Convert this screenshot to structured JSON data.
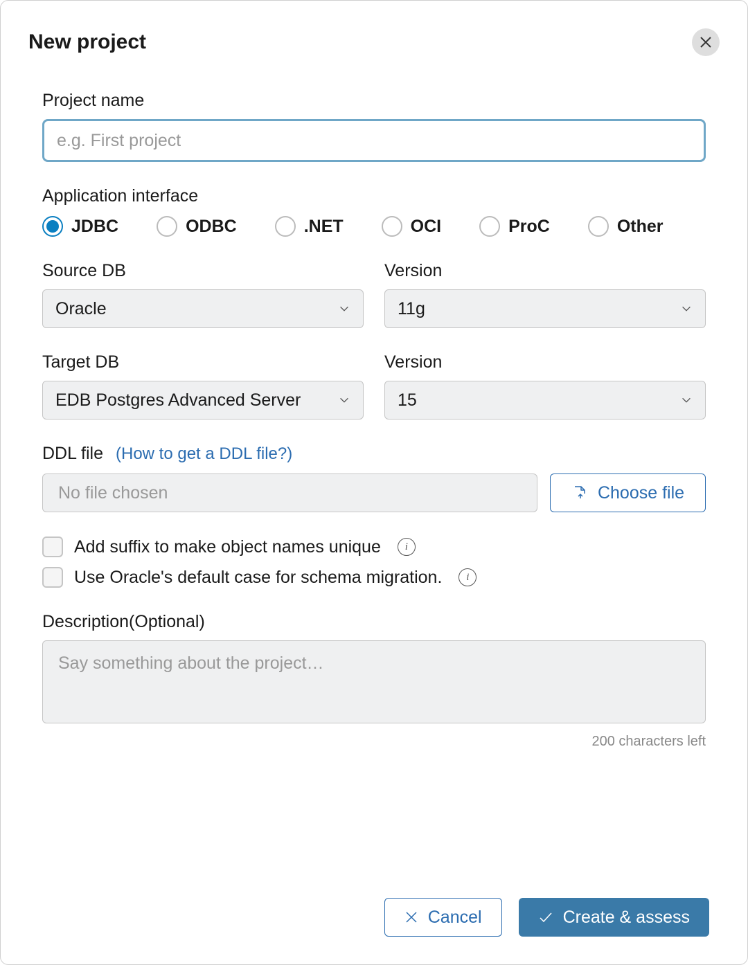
{
  "title": "New project",
  "projectName": {
    "label": "Project name",
    "placeholder": "e.g. First project"
  },
  "appInterface": {
    "label": "Application interface",
    "options": [
      "JDBC",
      "ODBC",
      ".NET",
      "OCI",
      "ProC",
      "Other"
    ],
    "selected": "JDBC"
  },
  "sourceDB": {
    "label": "Source DB",
    "value": "Oracle"
  },
  "sourceVersion": {
    "label": "Version",
    "value": "11g"
  },
  "targetDB": {
    "label": "Target DB",
    "value": "EDB Postgres Advanced Server"
  },
  "targetVersion": {
    "label": "Version",
    "value": "15"
  },
  "ddl": {
    "label": "DDL file",
    "helpText": "(How to get a DDL file?)",
    "placeholder": "No file chosen",
    "chooseBtn": "Choose file"
  },
  "checkboxes": {
    "suffix": "Add suffix to make object names unique",
    "oracleCase": "Use Oracle's default case for schema migration."
  },
  "description": {
    "label": "Description(Optional)",
    "placeholder": "Say something about the project…",
    "charCount": "200 characters left"
  },
  "buttons": {
    "cancel": "Cancel",
    "submit": "Create & assess"
  }
}
